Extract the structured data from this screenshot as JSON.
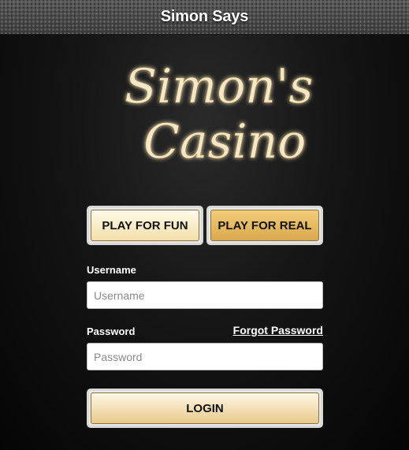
{
  "window": {
    "title": "Simon Says"
  },
  "logo": {
    "line1": "Simon's",
    "line2": "Casino"
  },
  "modes": {
    "fun_label": "PLAY FOR FUN",
    "real_label": "PLAY FOR REAL"
  },
  "form": {
    "username_label": "Username",
    "username_placeholder": "Username",
    "username_value": "",
    "password_label": "Password",
    "password_placeholder": "Password",
    "password_value": "",
    "forgot_label": "Forgot Password",
    "login_label": "LOGIN"
  },
  "colors": {
    "gold_light": "#f3dfa8",
    "gold_dark": "#d9a94c",
    "logo_cream": "#f4e8c8"
  }
}
